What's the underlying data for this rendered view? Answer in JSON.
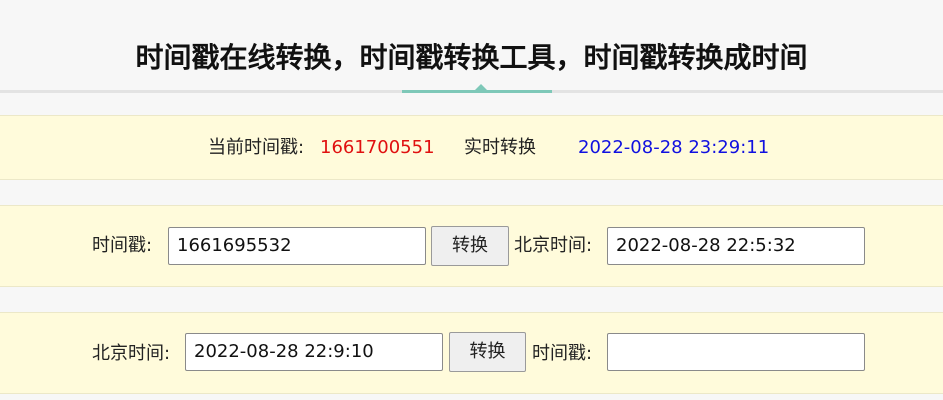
{
  "header": {
    "title": "时间戳在线转换，时间戳转换工具，时间戳转换成时间",
    "accent_color": "#7ec8b8"
  },
  "current": {
    "label": "当前时间戳:",
    "timestamp": "1661700551",
    "realtime_label": "实时转换",
    "realtime_value": "2022-08-28 23:29:11",
    "timestamp_color": "#e01010",
    "realtime_color": "#1010e0"
  },
  "ts_to_date": {
    "ts_label": "时间戳:",
    "ts_value": "1661695532",
    "button_label": "转换",
    "date_label": "北京时间:",
    "date_value": "2022-08-28 22:5:32"
  },
  "date_to_ts": {
    "date_label": "北京时间:",
    "date_value": "2022-08-28 22:9:10",
    "button_label": "转换",
    "ts_label": "时间戳:",
    "ts_value": ""
  },
  "colors": {
    "row_background": "#fffbdb",
    "page_background": "#f7f7f7"
  }
}
